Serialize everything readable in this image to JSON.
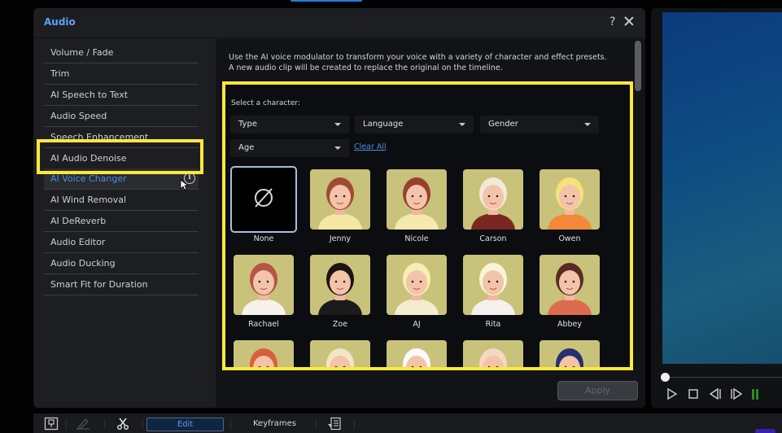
{
  "dialog": {
    "title": "Audio",
    "help_label": "?",
    "close_icon": "close-icon"
  },
  "sidebar": {
    "items": [
      {
        "label": "Volume / Fade"
      },
      {
        "label": "Trim"
      },
      {
        "label": "AI Speech to Text"
      },
      {
        "label": "Audio Speed"
      },
      {
        "label": "Speech Enhancement"
      },
      {
        "label": "AI Audio Denoise"
      },
      {
        "label": "AI Voice Changer",
        "active": true,
        "info_icon": "info-icon"
      },
      {
        "label": "AI Wind Removal"
      },
      {
        "label": "AI DeReverb"
      },
      {
        "label": "Audio Editor"
      },
      {
        "label": "Audio Ducking"
      },
      {
        "label": "Smart Fit for Duration"
      }
    ],
    "info_glyph": "i"
  },
  "main": {
    "description": "Use the AI voice modulator to transform your voice with a variety of character and effect presets. A new audio clip will be created to replace the original on the timeline.",
    "select_label": "Select a character:",
    "filters": [
      {
        "label": "Type"
      },
      {
        "label": "Language"
      },
      {
        "label": "Gender"
      },
      {
        "label": "Age"
      }
    ],
    "clear_all": "Clear All",
    "characters": [
      {
        "name": "None",
        "selected": true,
        "icon": "empty-set-icon"
      },
      {
        "name": "Jenny"
      },
      {
        "name": "Nicole"
      },
      {
        "name": "Carson"
      },
      {
        "name": "Owen"
      },
      {
        "name": "Rachael"
      },
      {
        "name": "Zoe"
      },
      {
        "name": "AJ"
      },
      {
        "name": "Rita"
      },
      {
        "name": "Abbey"
      },
      {
        "name": ""
      },
      {
        "name": ""
      },
      {
        "name": ""
      },
      {
        "name": ""
      },
      {
        "name": ""
      }
    ],
    "apply_label": "Apply"
  },
  "preview": {
    "controls": [
      "play-icon",
      "stop-icon",
      "previous-frame-icon",
      "next-frame-icon",
      "audio-level-icon"
    ]
  },
  "toolbar": {
    "edit_label": "Edit",
    "keyframes_label": "Keyframes"
  },
  "colors": {
    "highlight": "#ffe83a",
    "accent": "#4d8fe0",
    "thumb_bg": "#c9c27a"
  }
}
